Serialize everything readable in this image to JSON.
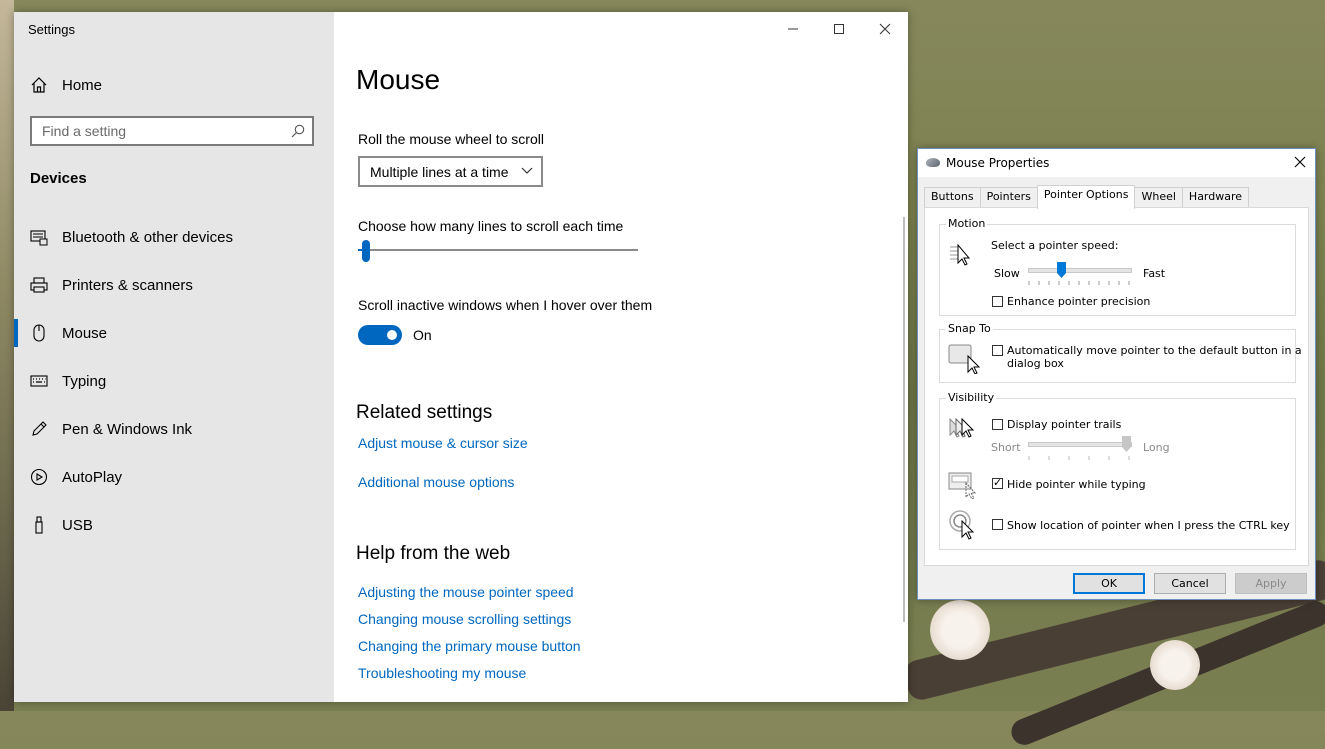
{
  "settings": {
    "window_title": "Settings",
    "home_label": "Home",
    "search_placeholder": "Find a setting",
    "section": "Devices",
    "nav": [
      {
        "label": "Bluetooth & other devices",
        "icon": "bluetooth-icon"
      },
      {
        "label": "Printers & scanners",
        "icon": "printer-icon"
      },
      {
        "label": "Mouse",
        "icon": "mouse-icon",
        "active": true
      },
      {
        "label": "Typing",
        "icon": "keyboard-icon"
      },
      {
        "label": "Pen & Windows Ink",
        "icon": "pen-icon"
      },
      {
        "label": "AutoPlay",
        "icon": "autoplay-icon"
      },
      {
        "label": "USB",
        "icon": "usb-icon"
      }
    ],
    "page_title": "Mouse",
    "wheel_label": "Roll the mouse wheel to scroll",
    "wheel_value": "Multiple lines at a time",
    "lines_label": "Choose how many lines to scroll each time",
    "lines_slider_fraction": 0.03,
    "inactive_label": "Scroll inactive windows when I hover over them",
    "inactive_state": "On",
    "related_title": "Related settings",
    "related_links": [
      "Adjust mouse & cursor size",
      "Additional mouse options"
    ],
    "help_title": "Help from the web",
    "help_links": [
      "Adjusting the mouse pointer speed",
      "Changing mouse scrolling settings",
      "Changing the primary mouse button",
      "Troubleshooting my mouse"
    ],
    "accent_color": "#0067c0"
  },
  "mouse_properties": {
    "title": "Mouse Properties",
    "tabs": [
      "Buttons",
      "Pointers",
      "Pointer Options",
      "Wheel",
      "Hardware"
    ],
    "selected_tab": "Pointer Options",
    "motion": {
      "group": "Motion",
      "speed_label": "Select a pointer speed:",
      "slow": "Slow",
      "fast": "Fast",
      "speed_fraction": 0.32,
      "precision_label": "Enhance pointer precision",
      "precision_checked": false
    },
    "snap": {
      "group": "Snap To",
      "label_line1": "Automatically move pointer to the default button in a",
      "label_line2": "dialog box",
      "checked": false
    },
    "visibility": {
      "group": "Visibility",
      "trails_label": "Display pointer trails",
      "trails_checked": false,
      "short": "Short",
      "long": "Long",
      "trails_fraction": 1.0,
      "hide_label": "Hide pointer while typing",
      "hide_checked": true,
      "ctrl_label": "Show location of pointer when I press the CTRL key",
      "ctrl_checked": false
    },
    "buttons": {
      "ok": "OK",
      "cancel": "Cancel",
      "apply": "Apply"
    }
  }
}
